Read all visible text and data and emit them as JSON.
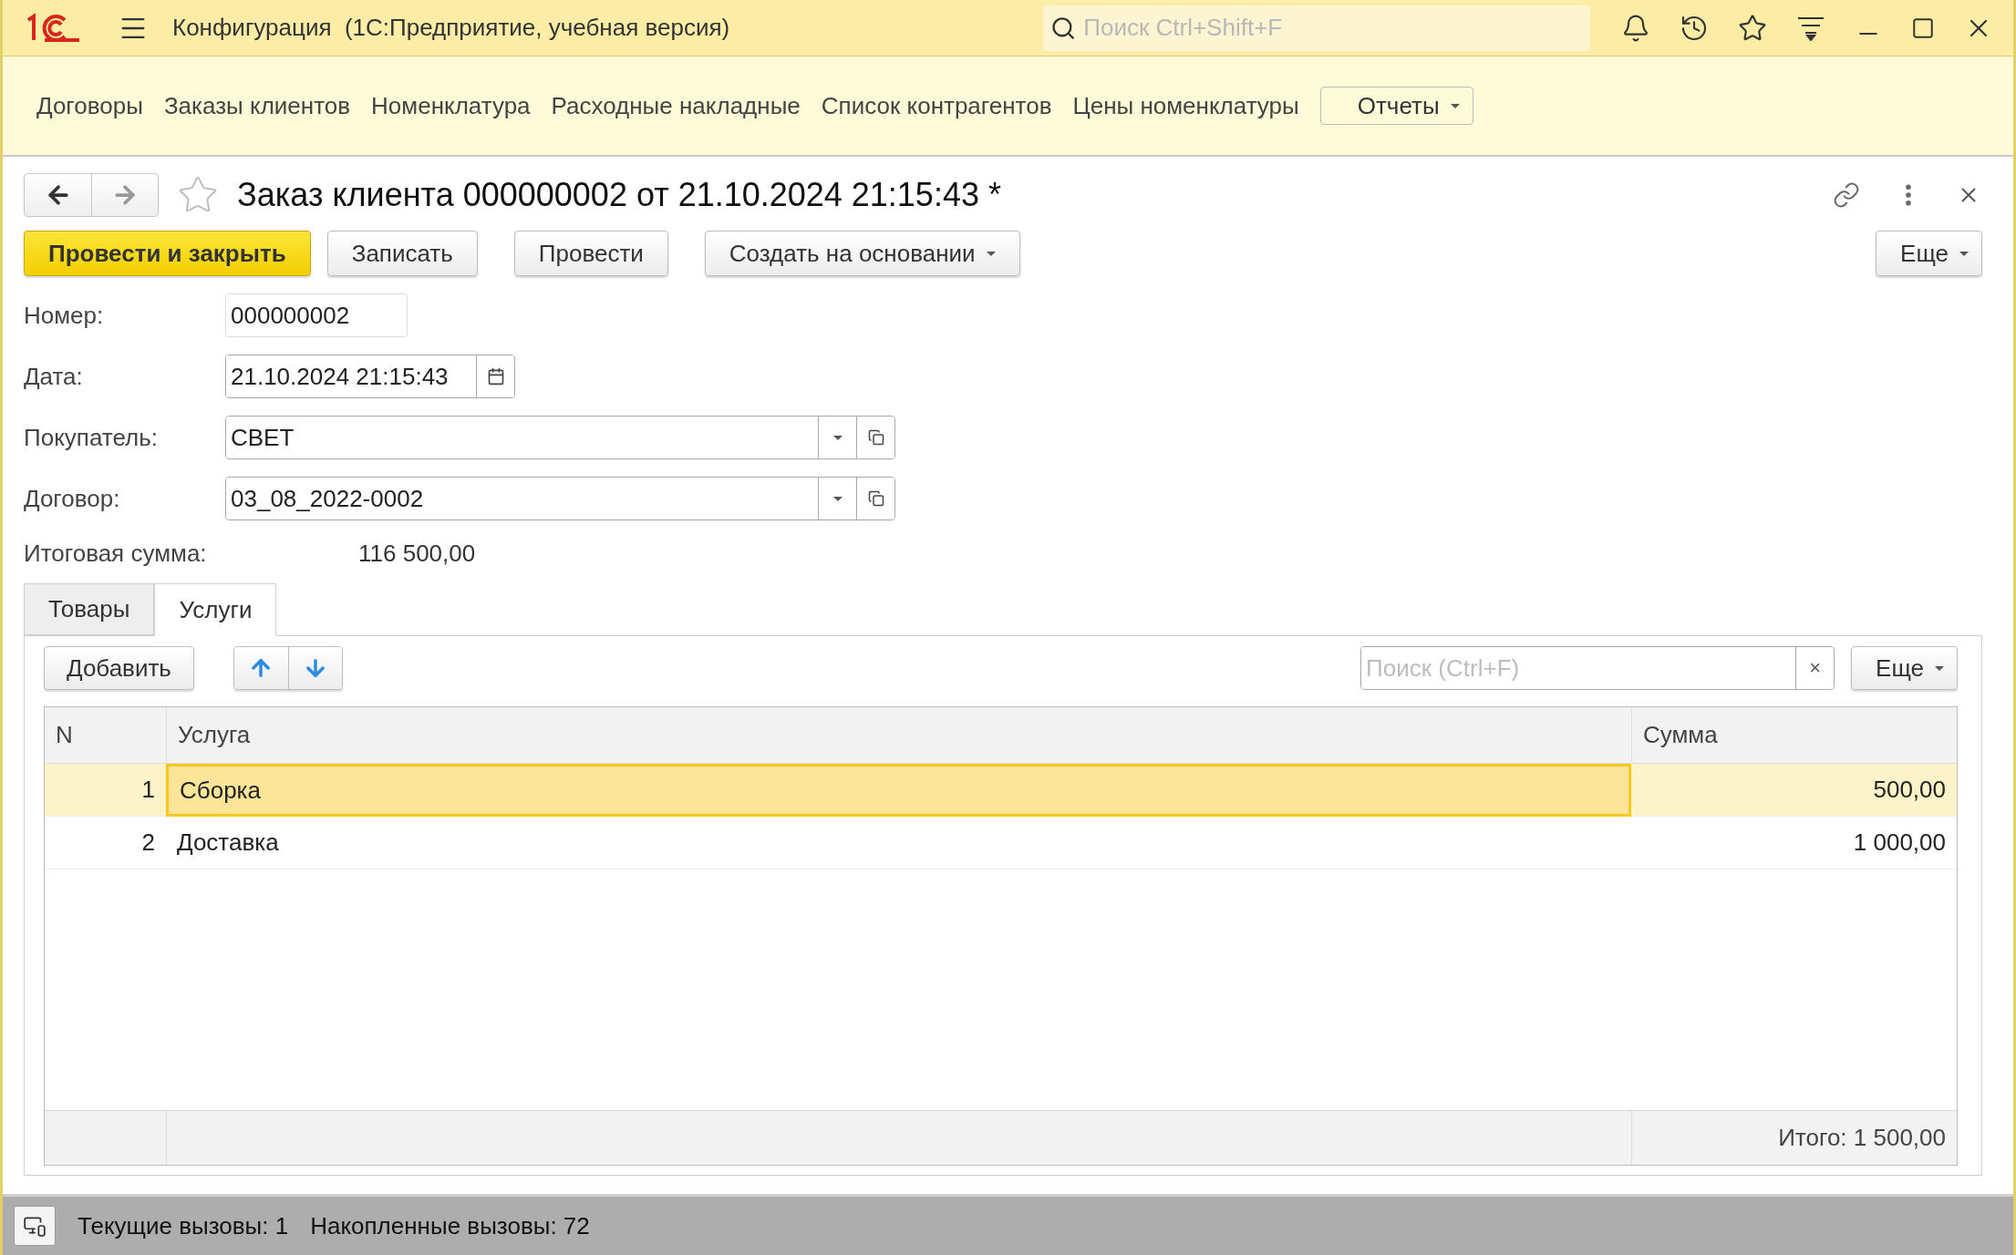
{
  "window": {
    "title": "Конфигурация  (1С:Предприятие, учебная версия)",
    "search_placeholder": "Поиск Ctrl+Shift+F"
  },
  "sections": [
    "Договоры",
    "Заказы клиентов",
    "Номенклатура",
    "Расходные накладные",
    "Список контрагентов",
    "Цены номенклатуры"
  ],
  "reports_menu": "Отчеты",
  "form": {
    "title": "Заказ клиента 000000002 от 21.10.2024 21:15:43 *",
    "favorite": false
  },
  "commands": [
    {
      "label": "Провести и закрыть",
      "kind": "default"
    },
    {
      "label": "Записать",
      "kind": "plain"
    },
    {
      "label": "Провести",
      "kind": "plain"
    },
    {
      "label": "Создать на основании",
      "kind": "menu"
    }
  ],
  "more": "Еще",
  "fields": [
    {
      "label": "Номер:",
      "value": "000000002",
      "kind": "text"
    },
    {
      "label": "Дата:",
      "value": "21.10.2024 21:15:43",
      "kind": "date"
    },
    {
      "label": "Покупатель:",
      "value": "СВЕТ",
      "kind": "ref"
    },
    {
      "label": "Договор:",
      "value": "03_08_2022-0002",
      "kind": "ref"
    }
  ],
  "total": {
    "label": "Итоговая сумма:",
    "value": "116 500,00"
  },
  "tabs": [
    {
      "label": "Товары",
      "selected": false
    },
    {
      "label": "Услуги",
      "selected": true
    }
  ],
  "table_toolbar": {
    "add": "Добавить",
    "search_placeholder": "Поиск (Ctrl+F)",
    "clear": "×",
    "more": "Еще"
  },
  "table": {
    "columns": [
      "N",
      "Услуга",
      "Сумма"
    ],
    "rows": [
      {
        "n": "1",
        "service": "Сборка",
        "amount": "500,00",
        "selected": true
      },
      {
        "n": "2",
        "service": "Доставка",
        "amount": "1 000,00",
        "selected": false
      }
    ],
    "footer": "Итого: 1 500,00"
  },
  "status_bar": {
    "items": [
      "Текущие вызовы: 1",
      "Накопленные вызовы: 72"
    ]
  }
}
